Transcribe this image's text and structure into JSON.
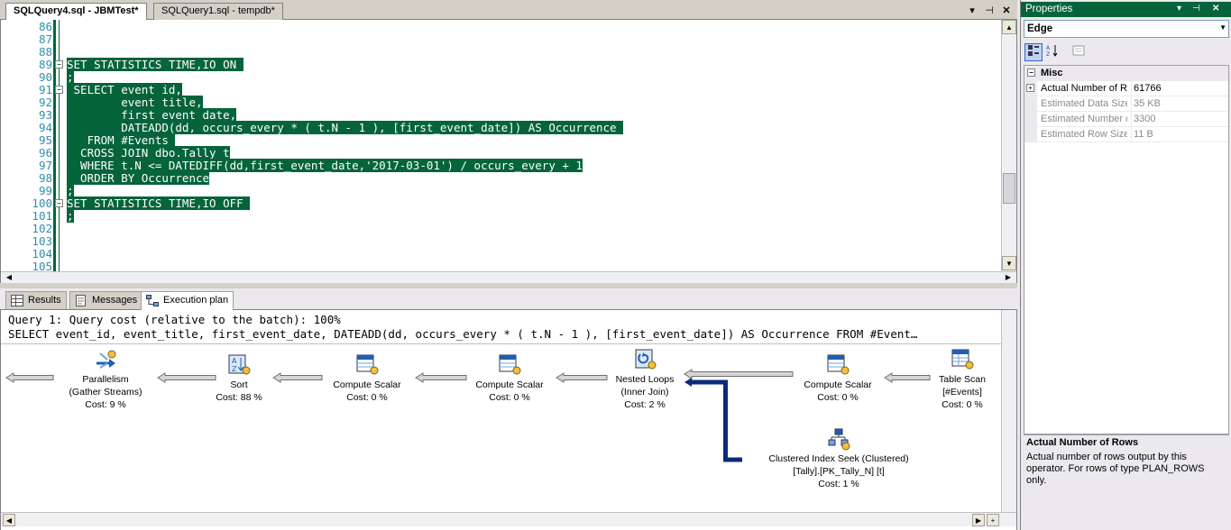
{
  "doc_tabs": [
    {
      "label": "SQLQuery4.sql - JBMTest*",
      "active": true
    },
    {
      "label": "SQLQuery1.sql - tempdb*",
      "active": false
    }
  ],
  "editor": {
    "lines": [
      {
        "num": "86",
        "text": "",
        "fold": ""
      },
      {
        "num": "87",
        "text": "",
        "fold": ""
      },
      {
        "num": "88",
        "text": "",
        "fold": ""
      },
      {
        "num": "89",
        "text": "SET STATISTICS TIME,IO ON ",
        "fold": "−"
      },
      {
        "num": "90",
        "text": ";",
        "fold": ""
      },
      {
        "num": "91",
        "text": " SELECT event_id,",
        "fold": "−"
      },
      {
        "num": "92",
        "text": "        event_title,",
        "fold": ""
      },
      {
        "num": "93",
        "text": "        first_event_date,",
        "fold": ""
      },
      {
        "num": "94",
        "text": "        DATEADD(dd, occurs_every * ( t.N - 1 ), [first_event_date]) AS Occurrence ",
        "fold": ""
      },
      {
        "num": "95",
        "text": "   FROM #Events ",
        "fold": ""
      },
      {
        "num": "96",
        "text": "  CROSS JOIN dbo.Tally t",
        "fold": ""
      },
      {
        "num": "97",
        "text": "  WHERE t.N <= DATEDIFF(dd,first_event_date,'2017-03-01') / occurs_every + 1",
        "fold": ""
      },
      {
        "num": "98",
        "text": "  ORDER BY Occurrence",
        "fold": ""
      },
      {
        "num": "99",
        "text": ";",
        "fold": ""
      },
      {
        "num": "100",
        "text": "SET STATISTICS TIME,IO OFF ",
        "fold": "−"
      },
      {
        "num": "101",
        "text": ";",
        "fold": ""
      },
      {
        "num": "102",
        "text": "",
        "fold": ""
      },
      {
        "num": "103",
        "text": "",
        "fold": ""
      },
      {
        "num": "104",
        "text": "",
        "fold": ""
      },
      {
        "num": "105",
        "text": "",
        "fold": ""
      }
    ]
  },
  "result_tabs": [
    {
      "label": "Results",
      "icon": "grid-icon",
      "active": false
    },
    {
      "label": "Messages",
      "icon": "messages-icon",
      "active": false
    },
    {
      "label": "Execution plan",
      "icon": "execution-plan-icon",
      "active": true
    }
  ],
  "plan": {
    "header1": "Query 1: Query cost (relative to the batch): 100%",
    "header2": "SELECT event_id, event_title, first_event_date, DATEADD(dd, occurs_every * ( t.N - 1 ), [first_event_date]) AS Occurrence FROM #Event…",
    "nodes": [
      {
        "id": "parallelism",
        "icon": "parallelism-icon",
        "lines": [
          "Parallelism",
          "(Gather Streams)",
          "Cost: 9 %"
        ]
      },
      {
        "id": "sort",
        "icon": "sort-icon",
        "lines": [
          "Sort",
          "Cost: 88 %"
        ]
      },
      {
        "id": "compute-scalar-1",
        "icon": "compute-scalar-icon",
        "lines": [
          "Compute Scalar",
          "Cost: 0 %"
        ]
      },
      {
        "id": "compute-scalar-2",
        "icon": "compute-scalar-icon",
        "lines": [
          "Compute Scalar",
          "Cost: 0 %"
        ]
      },
      {
        "id": "nested-loops",
        "icon": "nested-loops-icon",
        "lines": [
          "Nested Loops",
          "(Inner Join)",
          "Cost: 2 %"
        ]
      },
      {
        "id": "compute-scalar-3",
        "icon": "compute-scalar-icon",
        "lines": [
          "Compute Scalar",
          "Cost: 0 %"
        ]
      },
      {
        "id": "table-scan",
        "icon": "table-scan-icon",
        "lines": [
          "Table Scan",
          "[#Events]",
          "Cost: 0 %"
        ]
      },
      {
        "id": "index-seek",
        "icon": "clustered-index-seek-icon",
        "lines": [
          "Clustered Index Seek (Clustered)",
          "[Tally].[PK_Tally_N] [t]",
          "Cost: 1 %"
        ]
      }
    ]
  },
  "properties": {
    "title": "Properties",
    "object": "Edge",
    "category": "Misc",
    "rows": [
      {
        "name": "Actual Number of Rows",
        "value": "61766",
        "expandable": true,
        "enabled": true
      },
      {
        "name": "Estimated Data Size",
        "value": "35 KB",
        "expandable": false,
        "enabled": false
      },
      {
        "name": "Estimated Number of Rows",
        "value": "3300",
        "expandable": false,
        "enabled": false
      },
      {
        "name": "Estimated Row Size",
        "value": "11 B",
        "expandable": false,
        "enabled": false
      }
    ],
    "desc_title": "Actual Number of Rows",
    "desc_text": "Actual number of rows output by this operator. For rows of type PLAN_ROWS only."
  },
  "colors": {
    "selection": "#05643a",
    "line_numbers": "#2b91af",
    "edge_selected": "#0b2a7a"
  }
}
